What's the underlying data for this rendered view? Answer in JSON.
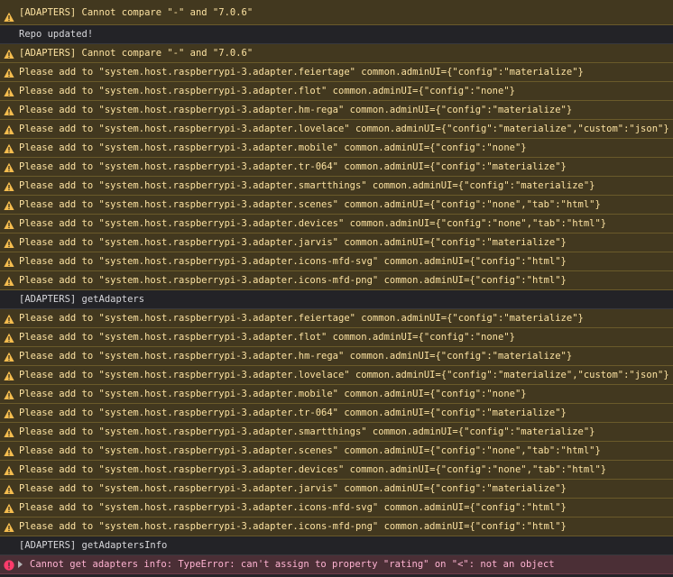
{
  "colors": {
    "background": "#232327",
    "warning_bg": "#42381f",
    "warning_text": "#fce2a1",
    "warning_icon": "#f5bd4f",
    "error_bg": "#4b2f36",
    "error_text": "#ffb3d2",
    "error_icon": "#ff3b6b",
    "log_text": "#d7d7db"
  },
  "messages": [
    {
      "level": "warn",
      "text": "[ADAPTERS] Cannot compare \"-\" and \"7.0.6\""
    },
    {
      "level": "log",
      "text": "Repo updated!"
    },
    {
      "level": "warn",
      "text": "[ADAPTERS] Cannot compare \"-\" and \"7.0.6\""
    },
    {
      "level": "warn",
      "text": "Please add to \"system.host.raspberrypi-3.adapter.feiertage\" common.adminUI={\"config\":\"materialize\"}"
    },
    {
      "level": "warn",
      "text": "Please add to \"system.host.raspberrypi-3.adapter.flot\" common.adminUI={\"config\":\"none\"}"
    },
    {
      "level": "warn",
      "text": "Please add to \"system.host.raspberrypi-3.adapter.hm-rega\" common.adminUI={\"config\":\"materialize\"}"
    },
    {
      "level": "warn",
      "text": "Please add to \"system.host.raspberrypi-3.adapter.lovelace\" common.adminUI={\"config\":\"materialize\",\"custom\":\"json\"}"
    },
    {
      "level": "warn",
      "text": "Please add to \"system.host.raspberrypi-3.adapter.mobile\" common.adminUI={\"config\":\"none\"}"
    },
    {
      "level": "warn",
      "text": "Please add to \"system.host.raspberrypi-3.adapter.tr-064\" common.adminUI={\"config\":\"materialize\"}"
    },
    {
      "level": "warn",
      "text": "Please add to \"system.host.raspberrypi-3.adapter.smartthings\" common.adminUI={\"config\":\"materialize\"}"
    },
    {
      "level": "warn",
      "text": "Please add to \"system.host.raspberrypi-3.adapter.scenes\" common.adminUI={\"config\":\"none\",\"tab\":\"html\"}"
    },
    {
      "level": "warn",
      "text": "Please add to \"system.host.raspberrypi-3.adapter.devices\" common.adminUI={\"config\":\"none\",\"tab\":\"html\"}"
    },
    {
      "level": "warn",
      "text": "Please add to \"system.host.raspberrypi-3.adapter.jarvis\" common.adminUI={\"config\":\"materialize\"}"
    },
    {
      "level": "warn",
      "text": "Please add to \"system.host.raspberrypi-3.adapter.icons-mfd-svg\" common.adminUI={\"config\":\"html\"}"
    },
    {
      "level": "warn",
      "text": "Please add to \"system.host.raspberrypi-3.adapter.icons-mfd-png\" common.adminUI={\"config\":\"html\"}"
    },
    {
      "level": "log",
      "text": "[ADAPTERS] getAdapters"
    },
    {
      "level": "warn",
      "text": "Please add to \"system.host.raspberrypi-3.adapter.feiertage\" common.adminUI={\"config\":\"materialize\"}"
    },
    {
      "level": "warn",
      "text": "Please add to \"system.host.raspberrypi-3.adapter.flot\" common.adminUI={\"config\":\"none\"}"
    },
    {
      "level": "warn",
      "text": "Please add to \"system.host.raspberrypi-3.adapter.hm-rega\" common.adminUI={\"config\":\"materialize\"}"
    },
    {
      "level": "warn",
      "text": "Please add to \"system.host.raspberrypi-3.adapter.lovelace\" common.adminUI={\"config\":\"materialize\",\"custom\":\"json\"}"
    },
    {
      "level": "warn",
      "text": "Please add to \"system.host.raspberrypi-3.adapter.mobile\" common.adminUI={\"config\":\"none\"}"
    },
    {
      "level": "warn",
      "text": "Please add to \"system.host.raspberrypi-3.adapter.tr-064\" common.adminUI={\"config\":\"materialize\"}"
    },
    {
      "level": "warn",
      "text": "Please add to \"system.host.raspberrypi-3.adapter.smartthings\" common.adminUI={\"config\":\"materialize\"}"
    },
    {
      "level": "warn",
      "text": "Please add to \"system.host.raspberrypi-3.adapter.scenes\" common.adminUI={\"config\":\"none\",\"tab\":\"html\"}"
    },
    {
      "level": "warn",
      "text": "Please add to \"system.host.raspberrypi-3.adapter.devices\" common.adminUI={\"config\":\"none\",\"tab\":\"html\"}"
    },
    {
      "level": "warn",
      "text": "Please add to \"system.host.raspberrypi-3.adapter.jarvis\" common.adminUI={\"config\":\"materialize\"}"
    },
    {
      "level": "warn",
      "text": "Please add to \"system.host.raspberrypi-3.adapter.icons-mfd-svg\" common.adminUI={\"config\":\"html\"}"
    },
    {
      "level": "warn",
      "text": "Please add to \"system.host.raspberrypi-3.adapter.icons-mfd-png\" common.adminUI={\"config\":\"html\"}"
    },
    {
      "level": "log",
      "text": "[ADAPTERS] getAdaptersInfo"
    },
    {
      "level": "error",
      "text": "Cannot get adapters info: TypeError: can't assign to property \"rating\" on \"<\": not an object",
      "expandable": true
    }
  ]
}
